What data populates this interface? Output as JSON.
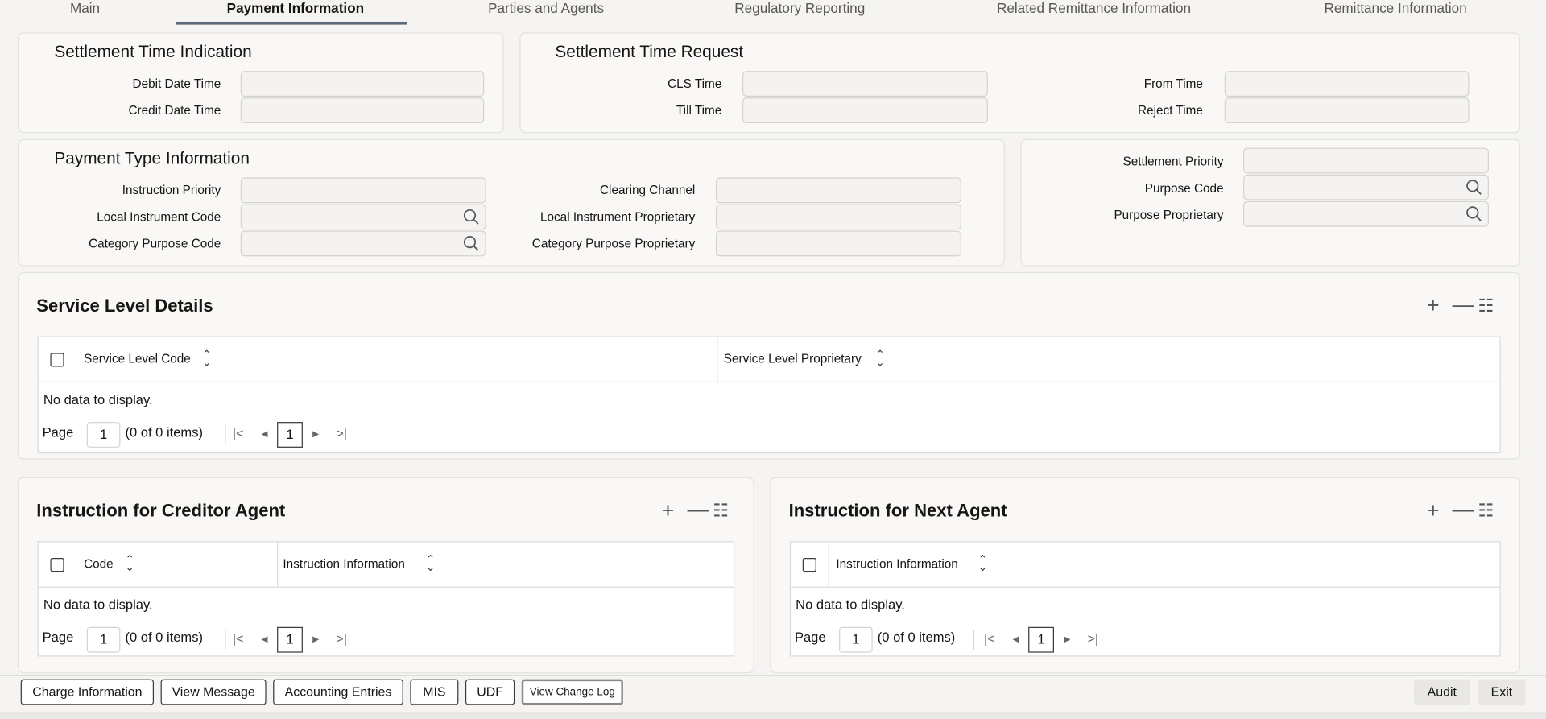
{
  "tabs": [
    "Main",
    "Payment Information",
    "Parties and Agents",
    "Regulatory Reporting",
    "Related Remittance Information",
    "Remittance Information"
  ],
  "active_tab": "Payment Information",
  "settlement_time_indication": {
    "title": "Settlement Time Indication",
    "debit_date_time": "Debit Date Time",
    "credit_date_time": "Credit Date Time"
  },
  "settlement_time_request": {
    "title": "Settlement Time Request",
    "cls_time": "CLS Time",
    "till_time": "Till Time",
    "from_time": "From Time",
    "reject_time": "Reject Time"
  },
  "payment_type_information": {
    "title": "Payment Type Information",
    "instruction_priority": "Instruction Priority",
    "local_instrument_code": "Local Instrument Code",
    "category_purpose_code": "Category Purpose Code",
    "clearing_channel": "Clearing Channel",
    "local_instrument_proprietary": "Local Instrument Proprietary",
    "category_purpose_proprietary": "Category Purpose Proprietary"
  },
  "settlement": {
    "settlement_priority": "Settlement Priority",
    "purpose_code": "Purpose Code",
    "purpose_proprietary": "Purpose Proprietary"
  },
  "service_level": {
    "title": "Service Level Details",
    "columns": [
      "Service Level Code",
      "Service Level Proprietary"
    ],
    "empty": "No data to display.",
    "page_label": "Page",
    "page": "1",
    "items": "(0 of 0 items)"
  },
  "creditor_agent": {
    "title": "Instruction for Creditor Agent",
    "columns": [
      "Code",
      "Instruction Information"
    ],
    "empty": "No data to display.",
    "page_label": "Page",
    "page": "1",
    "items": "(0 of 0 items)"
  },
  "next_agent": {
    "title": "Instruction for Next Agent",
    "columns": [
      "Instruction Information"
    ],
    "empty": "No data to display.",
    "page_label": "Page",
    "page": "1",
    "items": "(0 of 0 items)"
  },
  "footer": {
    "charge_information": "Charge Information",
    "view_message": "View Message",
    "accounting_entries": "Accounting Entries",
    "mis": "MIS",
    "udf": "UDF",
    "view_change_log": "View Change Log",
    "audit": "Audit",
    "exit": "Exit"
  }
}
